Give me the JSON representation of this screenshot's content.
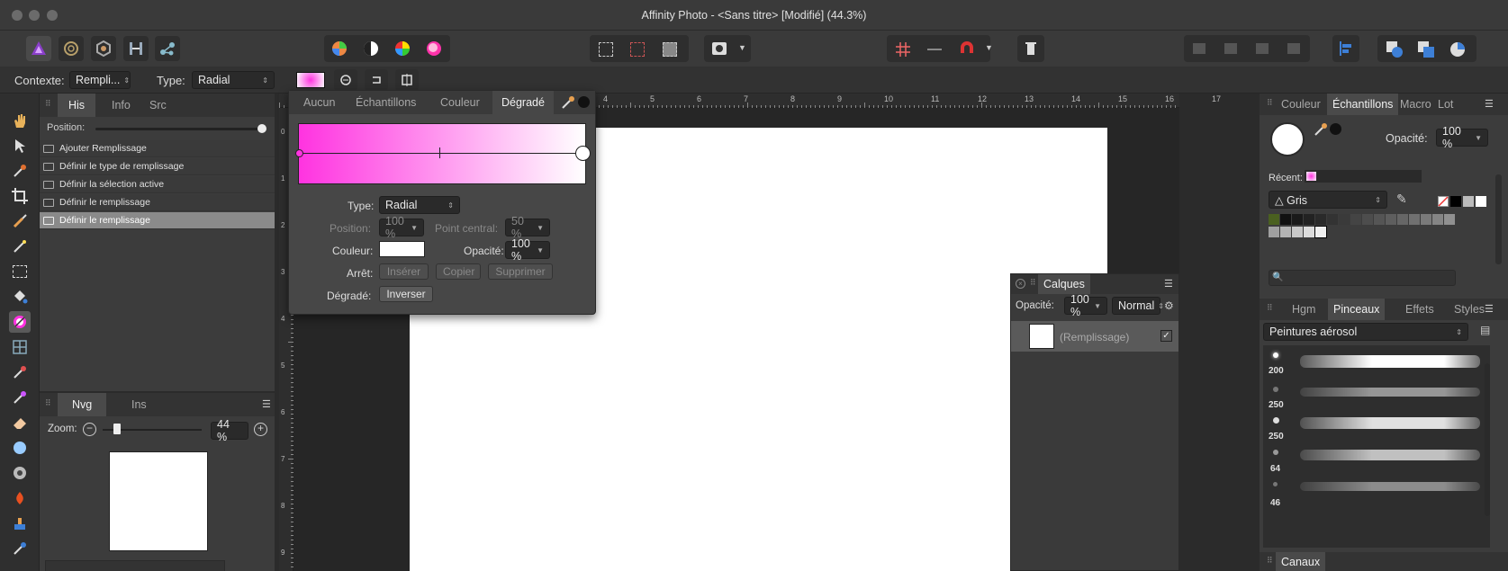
{
  "window": {
    "title": "Affinity Photo - <Sans titre> [Modifié] (44.3%)"
  },
  "context": {
    "label": "Contexte:",
    "value": "Rempli...",
    "type_label": "Type:",
    "type_value": "Radial"
  },
  "history": {
    "tabs": [
      "His",
      "Info",
      "Src"
    ],
    "position_label": "Position:",
    "items": [
      "Ajouter Remplissage",
      "Définir le type de remplissage",
      "Définir la sélection active",
      "Définir le remplissage",
      "Définir le remplissage"
    ]
  },
  "navigator": {
    "tabs": [
      "Nvg",
      "Ins"
    ],
    "zoom_label": "Zoom:",
    "zoom_value": "44 %"
  },
  "ruler": {
    "h_ticks": [
      "4",
      "5",
      "6",
      "7",
      "8",
      "9",
      "10",
      "11",
      "12",
      "13",
      "14",
      "15",
      "16",
      "17"
    ],
    "v_ticks": [
      "0",
      "1",
      "2",
      "3",
      "4",
      "5",
      "6",
      "7",
      "8",
      "9"
    ]
  },
  "gradient_popup": {
    "tabs": [
      "Aucun",
      "Échantillons",
      "Couleur",
      "Dégradé"
    ],
    "type_label": "Type:",
    "type_value": "Radial",
    "position_label": "Position:",
    "position_value": "100 %",
    "midpoint_label": "Point central:",
    "midpoint_value": "50 %",
    "color_label": "Couleur:",
    "opacity_label": "Opacité:",
    "opacity_value": "100 %",
    "stop_label": "Arrêt:",
    "insert_label": "Insérer",
    "copy_label": "Copier",
    "delete_label": "Supprimer",
    "gradient_label": "Dégradé:",
    "invert_label": "Inverser"
  },
  "layers": {
    "title": "Calques",
    "opacity_label": "Opacité:",
    "opacity_value": "100 %",
    "blend_value": "Normal",
    "layer_name": "(Remplissage)"
  },
  "swatches_panel": {
    "tabs": [
      "Couleur",
      "Échantillons",
      "Macro",
      "Lot"
    ],
    "opacity_label": "Opacité:",
    "opacity_value": "100 %",
    "recent_label": "Récent:",
    "palette_value": "Gris"
  },
  "brushes_panel": {
    "tabs": [
      "Hgm",
      "Pinceaux",
      "Effets",
      "Styles"
    ],
    "category_value": "Peintures aérosol",
    "sizes": [
      "200",
      "250",
      "250",
      "64",
      "46"
    ]
  },
  "channels": {
    "title": "Canaux"
  },
  "colors": {
    "gradient_start": "#ff33e0",
    "gradient_end": "#ffffff",
    "accent": "#3d7fd6"
  }
}
